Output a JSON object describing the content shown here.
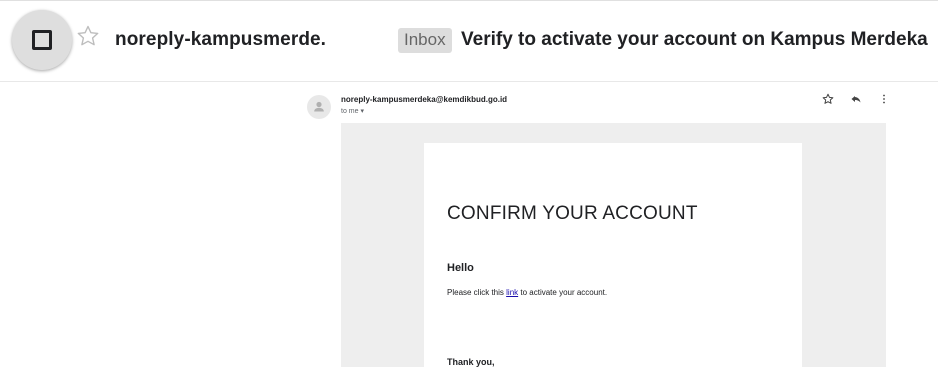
{
  "list_item": {
    "sender": "noreply-kampusmerde.",
    "label": "Inbox",
    "subject": "Verify to activate your account on Kampus Merdeka"
  },
  "message": {
    "from": "noreply-kampusmerdeka@kemdikbud.go.id",
    "to": "to me ▾",
    "icons": [
      "star-icon",
      "reply-icon",
      "more-vert-icon"
    ]
  },
  "email_content": {
    "title": "CONFIRM YOUR ACCOUNT",
    "greeting": "Hello",
    "instruction_before": "Please click this ",
    "link_text": "link",
    "instruction_after": " to activate your account.",
    "closing": "Thank you,"
  },
  "colors": {
    "text": "#202124",
    "link": "#1a0dab",
    "badge_bg": "#dddddd",
    "body_bg": "#eeeeee"
  }
}
